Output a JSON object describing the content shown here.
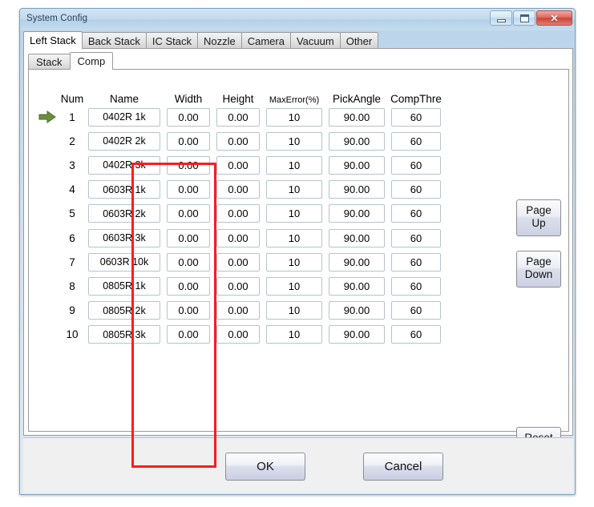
{
  "window": {
    "title": "System Config",
    "controls": {
      "minimize": "minimize-icon",
      "maximize": "maximize-icon",
      "close": "✕"
    }
  },
  "outer_tabs": [
    {
      "label": "Left Stack",
      "active": true
    },
    {
      "label": "Back Stack",
      "active": false
    },
    {
      "label": "IC Stack",
      "active": false
    },
    {
      "label": "Nozzle",
      "active": false
    },
    {
      "label": "Camera",
      "active": false
    },
    {
      "label": "Vacuum",
      "active": false
    },
    {
      "label": "Other",
      "active": false
    }
  ],
  "inner_tabs": [
    {
      "label": "Stack",
      "active": false
    },
    {
      "label": "Comp",
      "active": true
    }
  ],
  "grid": {
    "columns": [
      {
        "key": "num",
        "label": "Num"
      },
      {
        "key": "name",
        "label": "Name"
      },
      {
        "key": "width",
        "label": "Width"
      },
      {
        "key": "height",
        "label": "Height"
      },
      {
        "key": "max_error",
        "label": "MaxError(%)"
      },
      {
        "key": "pick_angle",
        "label": "PickAngle"
      },
      {
        "key": "comp_thre",
        "label": "CompThre"
      }
    ],
    "selected_row": 1,
    "rows": [
      {
        "num": "1",
        "name": "0402R 1k",
        "width": "0.00",
        "height": "0.00",
        "max_error": "10",
        "pick_angle": "90.00",
        "comp_thre": "60",
        "marker": true
      },
      {
        "num": "2",
        "name": "0402R 2k",
        "width": "0.00",
        "height": "0.00",
        "max_error": "10",
        "pick_angle": "90.00",
        "comp_thre": "60",
        "marker": false
      },
      {
        "num": "3",
        "name": "0402R 3k",
        "width": "0.00",
        "height": "0.00",
        "max_error": "10",
        "pick_angle": "90.00",
        "comp_thre": "60",
        "marker": false
      },
      {
        "num": "4",
        "name": "0603R 1k",
        "width": "0.00",
        "height": "0.00",
        "max_error": "10",
        "pick_angle": "90.00",
        "comp_thre": "60",
        "marker": false
      },
      {
        "num": "5",
        "name": "0603R 2k",
        "width": "0.00",
        "height": "0.00",
        "max_error": "10",
        "pick_angle": "90.00",
        "comp_thre": "60",
        "marker": false
      },
      {
        "num": "6",
        "name": "0603R 3k",
        "width": "0.00",
        "height": "0.00",
        "max_error": "10",
        "pick_angle": "90.00",
        "comp_thre": "60",
        "marker": false
      },
      {
        "num": "7",
        "name": "0603R 10k",
        "width": "0.00",
        "height": "0.00",
        "max_error": "10",
        "pick_angle": "90.00",
        "comp_thre": "60",
        "marker": false
      },
      {
        "num": "8",
        "name": "0805R 1k",
        "width": "0.00",
        "height": "0.00",
        "max_error": "10",
        "pick_angle": "90.00",
        "comp_thre": "60",
        "marker": false
      },
      {
        "num": "9",
        "name": "0805R 2k",
        "width": "0.00",
        "height": "0.00",
        "max_error": "10",
        "pick_angle": "90.00",
        "comp_thre": "60",
        "marker": false
      },
      {
        "num": "10",
        "name": "0805R 3k",
        "width": "0.00",
        "height": "0.00",
        "max_error": "10",
        "pick_angle": "90.00",
        "comp_thre": "60",
        "marker": false
      }
    ]
  },
  "side_buttons": {
    "page_up_line1": "Page",
    "page_up_line2": "Up",
    "page_down_line1": "Page",
    "page_down_line2": "Down",
    "reset": "Reset"
  },
  "footer": {
    "ok": "OK",
    "cancel": "Cancel"
  },
  "annotation": {
    "highlight_color": "#fc1c1c",
    "highlight_target": "Name"
  },
  "colors": {
    "titlebar": "#bcd7ec",
    "panel": "#ffffff",
    "footer": "#f0f0f0",
    "marker_arrow": "#6b8e3e",
    "close_button": "#cc4338"
  }
}
